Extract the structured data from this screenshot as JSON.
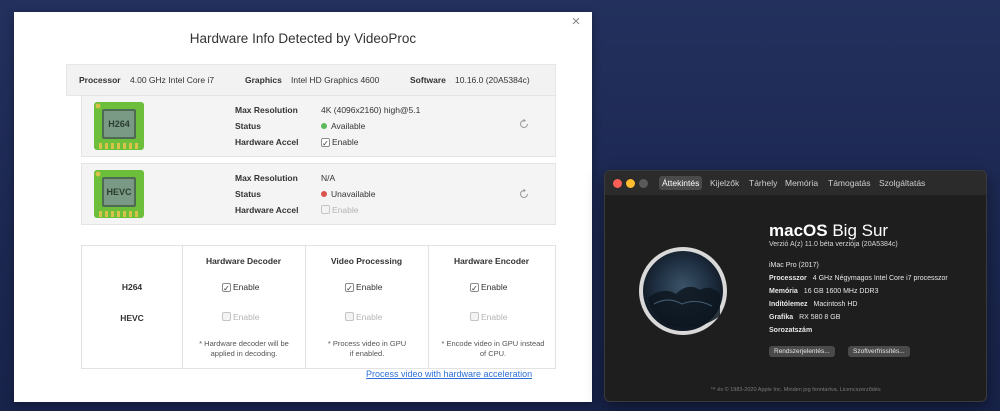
{
  "videoproc": {
    "title": "Hardware Info Detected by VideoProc",
    "close_glyph": "×",
    "system": {
      "processor_label": "Processor",
      "processor_value": "4.00 GHz Intel Core i7",
      "graphics_label": "Graphics",
      "graphics_value": "Intel HD Graphics 4600",
      "software_label": "Software",
      "software_value": "10.16.0 (20A5384c)"
    },
    "codecs": [
      {
        "chip_label": "H264",
        "max_resolution_label": "Max Resolution",
        "max_resolution_value": "4K (4096x2160) high@5.1",
        "status_label": "Status",
        "status_value": "Available",
        "status_color": "#5cb85c",
        "hw_accel_label": "Hardware Accel",
        "hw_accel_checked": true,
        "hw_accel_text": "Enable"
      },
      {
        "chip_label": "HEVC",
        "max_resolution_label": "Max Resolution",
        "max_resolution_value": "N/A",
        "status_label": "Status",
        "status_value": "Unavailable",
        "status_color": "#d9534f",
        "hw_accel_label": "Hardware Accel",
        "hw_accel_checked": false,
        "hw_accel_text": "Enable"
      }
    ],
    "matrix": {
      "columns": [
        "Hardware Decoder",
        "Video Processing",
        "Hardware Encoder"
      ],
      "rows": [
        "H264",
        "HEVC"
      ],
      "cell_text": "Enable",
      "states": [
        [
          true,
          true,
          true
        ],
        [
          false,
          false,
          false
        ]
      ],
      "notes": [
        [
          "* Hardware decoder will be",
          "applied in decoding."
        ],
        [
          "* Process video in GPU",
          "if enabled."
        ],
        [
          "* Encode video in GPU instead",
          "of CPU."
        ]
      ]
    },
    "link": "Process video with hardware acceleration"
  },
  "about_mac": {
    "tabs": [
      "Áttekintés",
      "Kijelzők",
      "Tárhely",
      "Memória",
      "Támogatás",
      "Szolgáltatás"
    ],
    "active_tab": 0,
    "traffic_lights": [
      "#ff5f57",
      "#febc2e",
      "#5a5a5a"
    ],
    "os_name_bold": "macOS",
    "os_name_rest": "Big Sur",
    "os_version": "Verzió A(z) 11.0 béta verziója (20A5384c)",
    "model": "iMac Pro (2017)",
    "specs": [
      {
        "label": "Processzor",
        "value": "4 GHz Négymagos Intel Core i7 processzor"
      },
      {
        "label": "Memória",
        "value": "16 GB 1600 MHz DDR3"
      },
      {
        "label": "Indítólemez",
        "value": "Macintosh HD"
      },
      {
        "label": "Grafika",
        "value": "RX 580 8 GB"
      },
      {
        "label": "Sorozatszám",
        "value": ""
      }
    ],
    "buttons": [
      "Rendszerjelentés...",
      "Szoftverfrissítés..."
    ],
    "copyright": "™ és © 1983-2020 Apple Inc. Minden jog fenntartva. Licencszerződés"
  }
}
